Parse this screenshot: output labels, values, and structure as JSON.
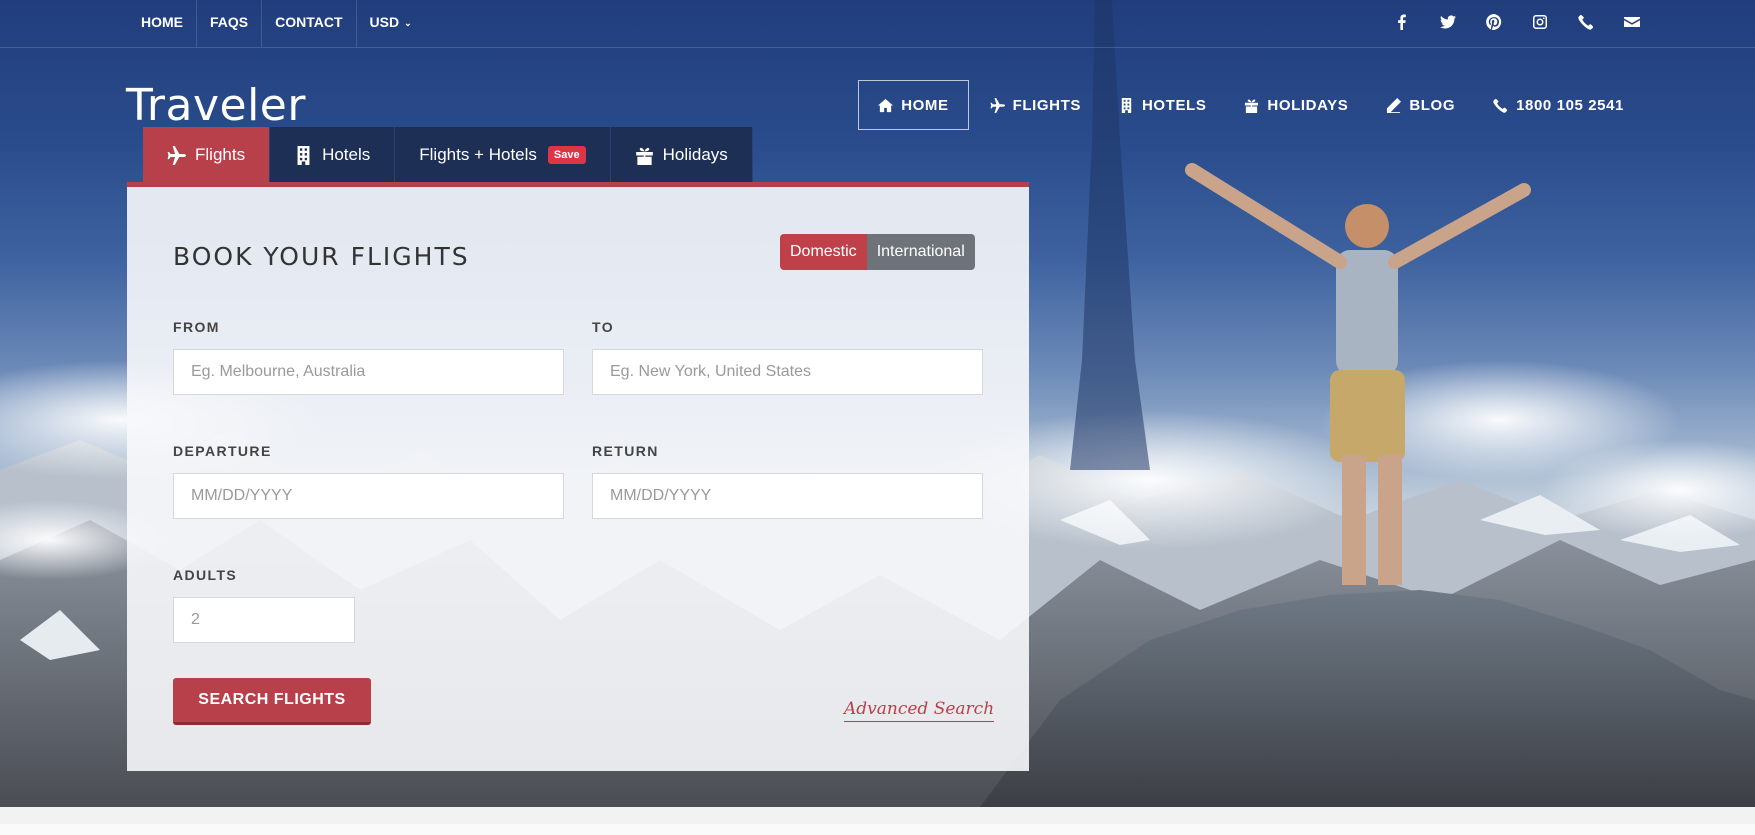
{
  "topbar": {
    "links": [
      "HOME",
      "FAQS",
      "CONTACT"
    ],
    "currency": "USD",
    "social_icons": [
      "facebook-icon",
      "twitter-icon",
      "pinterest-icon",
      "instagram-icon",
      "phone-icon",
      "envelope-icon"
    ]
  },
  "brand": {
    "logo": "Traveler"
  },
  "mainnav": {
    "items": [
      {
        "label": "HOME",
        "icon": "home-icon"
      },
      {
        "label": "FLIGHTS",
        "icon": "plane-icon"
      },
      {
        "label": "HOTELS",
        "icon": "building-icon"
      },
      {
        "label": "HOLIDAYS",
        "icon": "gift-icon"
      },
      {
        "label": "BLOG",
        "icon": "pencil-icon"
      },
      {
        "label": "1800 105 2541",
        "icon": "phone-icon"
      }
    ]
  },
  "tabs": {
    "items": [
      {
        "label": "Flights",
        "icon": "plane-icon"
      },
      {
        "label": "Hotels",
        "icon": "building-icon"
      },
      {
        "label": "Flights + Hotels",
        "badge": "Save"
      },
      {
        "label": "Holidays",
        "icon": "gift-icon"
      }
    ],
    "active": "Flights"
  },
  "form": {
    "title": "BOOK YOUR FLIGHTS",
    "trip_type": {
      "domestic": "Domestic",
      "international": "International",
      "selected": "Domestic"
    },
    "from": {
      "label": "FROM",
      "placeholder": "Eg. Melbourne, Australia"
    },
    "to": {
      "label": "TO",
      "placeholder": "Eg. New York, United States"
    },
    "departure": {
      "label": "DEPARTURE",
      "placeholder": "MM/DD/YYYY"
    },
    "return": {
      "label": "RETURN",
      "placeholder": "MM/DD/YYYY"
    },
    "adults": {
      "label": "ADULTS",
      "placeholder": "2"
    },
    "submit": "SEARCH FLIGHTS",
    "advanced": "Advanced Search"
  },
  "colors": {
    "accent": "#b8404b",
    "tab_bg": "#1d2f55",
    "toggle_off": "#6d7378",
    "sky": "#2a4c8c"
  }
}
